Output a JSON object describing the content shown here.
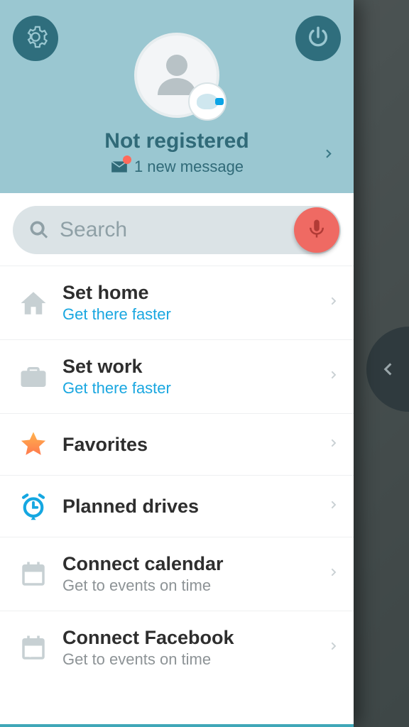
{
  "header": {
    "title": "Not registered",
    "messages_text": "1 new message"
  },
  "search": {
    "placeholder": "Search"
  },
  "rows": {
    "home": {
      "title": "Set home",
      "sub": "Get there faster"
    },
    "work": {
      "title": "Set work",
      "sub": "Get there faster"
    },
    "favorites": {
      "title": "Favorites"
    },
    "planned": {
      "title": "Planned drives"
    },
    "calendar": {
      "title": "Connect calendar",
      "sub": "Get to events on time"
    },
    "facebook": {
      "title": "Connect Facebook",
      "sub": "Get to events on time"
    }
  }
}
